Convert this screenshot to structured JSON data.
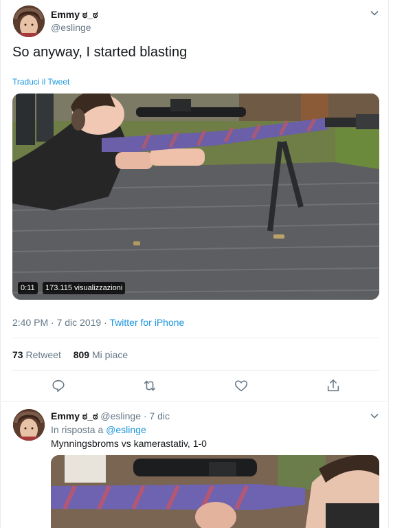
{
  "main_tweet": {
    "author_name": "Emmy ಠ_ಠ",
    "author_handle": "@eslinge",
    "text": "So anyway, I started blasting",
    "translate_link": "Traduci il Tweet",
    "video": {
      "duration": "0:11",
      "views": "173.115 visualizzazioni"
    },
    "timestamp": "2:40 PM · 7 dic 2019 · ",
    "source": "Twitter for iPhone",
    "stats": {
      "retweets_count": "73",
      "retweets_label": "Retweet",
      "likes_count": "809",
      "likes_label": "Mi piace"
    },
    "actions": [
      "reply-icon",
      "retweet-icon",
      "like-icon",
      "share-icon"
    ]
  },
  "reply_tweet": {
    "author_name": "Emmy ಠ_ಠ",
    "author_handle": "@eslinge",
    "date": " · 7 dic",
    "in_reply_prefix": "In risposta a ",
    "in_reply_handle": "@eslinge",
    "text": "Mynningsbroms vs kamerastativ, 1-0"
  },
  "colors": {
    "link_blue": "#1b95e0",
    "secondary_text": "#657786",
    "primary_text": "#14171a",
    "border": "#e6ecf0"
  }
}
